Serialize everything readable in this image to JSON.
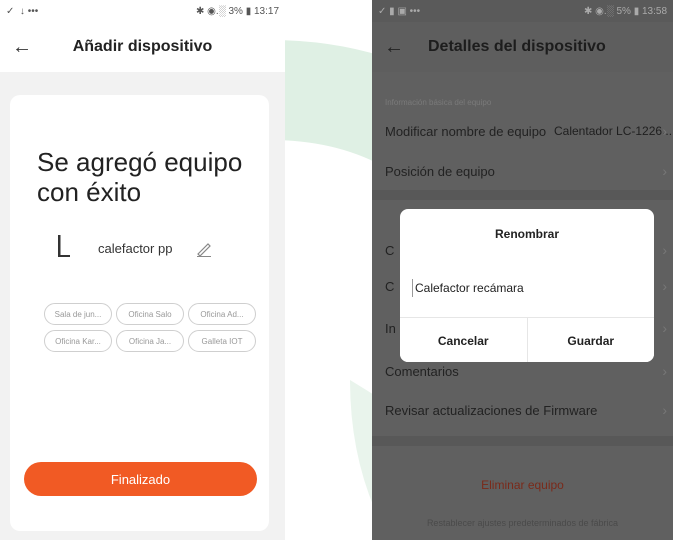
{
  "watermark_color": "#dff0e4",
  "left": {
    "status": {
      "left_icons": "✓  ↓ •••",
      "right": "✱ ◉.░ 3% ▮ 13:17"
    },
    "title": "Añadir dispositivo",
    "success_text": "Se agregó equipo con éxito",
    "device_name": "calefactor pp",
    "rooms": [
      "Sala de jun...",
      "Oficina Salo",
      "Oficina Ad...",
      "Oficina Kar...",
      "Oficina Ja...",
      "Galleta IOT"
    ],
    "finish_label": "Finalizado",
    "accent": "#f15a24"
  },
  "right": {
    "status": {
      "left_icons": "✓ ▮ ▣ •••",
      "right": "✱ ◉.░ 5% ▮ 13:58"
    },
    "title": "Detalles del dispositivo",
    "section_label": "Información básica del equipo",
    "rows": [
      {
        "label": "Modificar nombre de equipo",
        "value": "Calentador LC-1226..."
      },
      {
        "label": "Posición de equipo",
        "value": ""
      },
      {
        "label": "C",
        "value": ""
      },
      {
        "label": "C",
        "value": ""
      },
      {
        "label": "In",
        "value": ""
      },
      {
        "label": "Comentarios",
        "value": ""
      },
      {
        "label": "Revisar actualizaciones de Firmware",
        "value": ""
      }
    ],
    "delete_label": "Eliminar equipo",
    "reset_label": "Restablecer ajustes predeterminados de fábrica",
    "dialog": {
      "title": "Renombrar",
      "input_value": "Calefactor recámara",
      "cancel": "Cancelar",
      "save": "Guardar"
    }
  }
}
